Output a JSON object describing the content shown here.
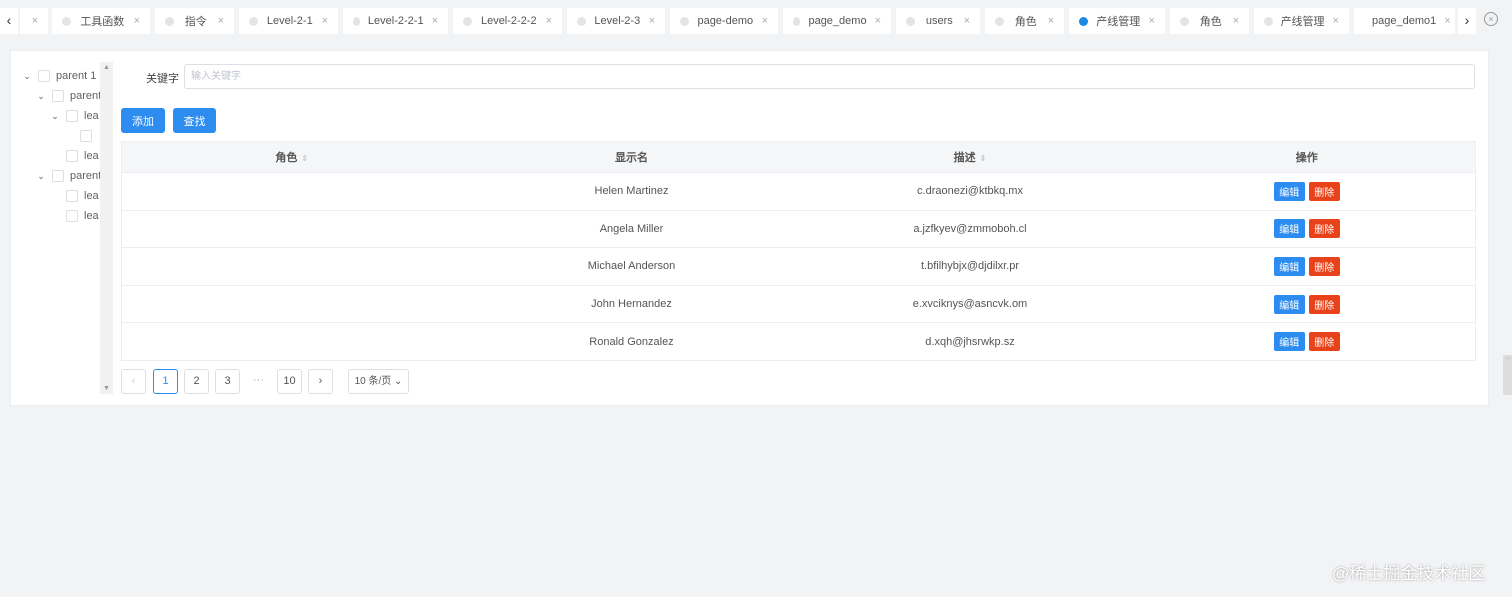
{
  "tabs": [
    {
      "label": "",
      "active": false
    },
    {
      "label": "工具函数"
    },
    {
      "label": "指令"
    },
    {
      "label": "Level-2-1"
    },
    {
      "label": "Level-2-2-1"
    },
    {
      "label": "Level-2-2-2"
    },
    {
      "label": "Level-2-3"
    },
    {
      "label": "page-demo"
    },
    {
      "label": "page_demo"
    },
    {
      "label": "users"
    },
    {
      "label": "角色"
    },
    {
      "label": "产线管理",
      "active": true
    },
    {
      "label": "角色"
    },
    {
      "label": "产线管理"
    },
    {
      "label": "page_demo1"
    }
  ],
  "icons": {
    "prev": "‹",
    "next": "›",
    "close": "×",
    "close_all": "×"
  },
  "tree": [
    {
      "label": "parent 1",
      "depth": 0,
      "expand": true
    },
    {
      "label": "parent",
      "depth": 1,
      "expand": true
    },
    {
      "label": "lea",
      "depth": 2,
      "expand": true
    },
    {
      "label": "",
      "depth": 3,
      "expand": false
    },
    {
      "label": "lea",
      "depth": 2,
      "expand": false
    },
    {
      "label": "parent",
      "depth": 1,
      "expand": true
    },
    {
      "label": "lea",
      "depth": 2,
      "expand": false
    },
    {
      "label": "lea",
      "depth": 2,
      "expand": false
    }
  ],
  "search": {
    "label": "关键字",
    "placeholder": "输入关键字"
  },
  "buttons": {
    "add": "添加",
    "find": "查找"
  },
  "table": {
    "headers": [
      "角色",
      "显示名",
      "描述",
      "操作"
    ],
    "rows": [
      {
        "role": "",
        "name": "Helen Martinez",
        "desc": "c.draonezi@ktbkq.mx"
      },
      {
        "role": "",
        "name": "Angela Miller",
        "desc": "a.jzfkyev@zmmoboh.cl"
      },
      {
        "role": "",
        "name": "Michael Anderson",
        "desc": "t.bfilhybjx@djdilxr.pr"
      },
      {
        "role": "",
        "name": "John Hernandez",
        "desc": "e.xvciknys@asncvk.om"
      },
      {
        "role": "",
        "name": "Ronald Gonzalez",
        "desc": "d.xqh@jhsrwkp.sz"
      }
    ],
    "edit": "编辑",
    "delete": "删除"
  },
  "pagination": {
    "prev": "‹",
    "pages": [
      "1",
      "2",
      "3"
    ],
    "ellipsis": "···",
    "last": "10",
    "next": "›",
    "size": "10 条/页",
    "current": "1"
  },
  "watermark": "@稀土掘金技术社区"
}
